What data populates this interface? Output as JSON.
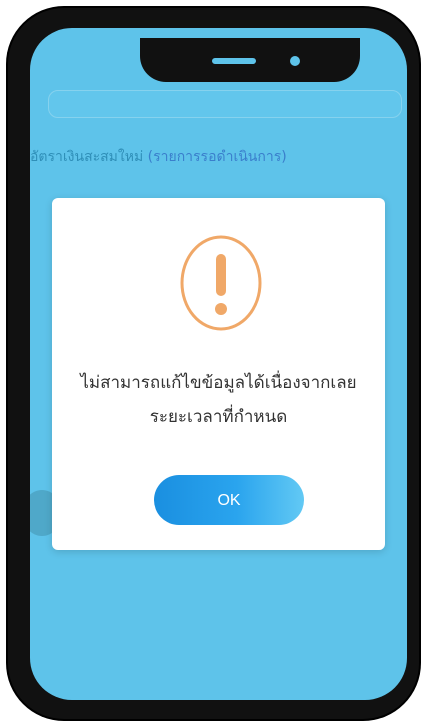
{
  "background": {
    "label_text": "อัตราเงินสะสมใหม่",
    "label_highlight": "(รายการรอดำเนินการ)"
  },
  "dialog": {
    "icon": "exclamation-circle-icon",
    "icon_color": "#f0a868",
    "message": "ไม่สามารถแก้ไขข้อมูลได้เนื่องจากเลยระยะเวลาที่กำหนด",
    "ok_label": "OK"
  },
  "colors": {
    "screen_bg": "#5ec3ea",
    "button_start": "#1a8fe0",
    "button_end": "#62c9f4"
  }
}
